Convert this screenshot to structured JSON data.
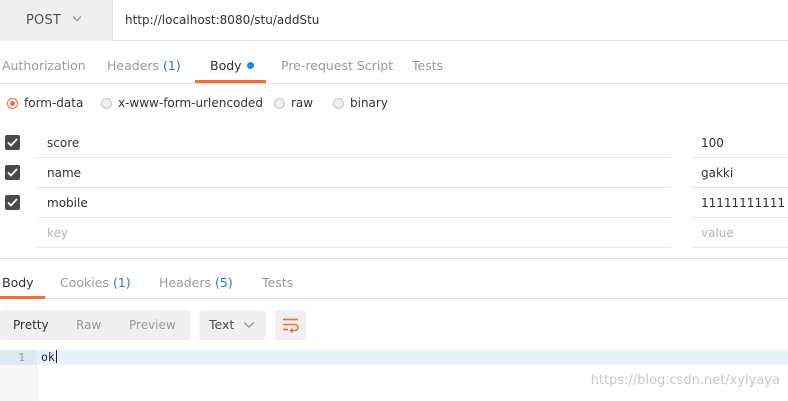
{
  "request": {
    "method": "POST",
    "url": "http://localhost:8080/stu/addStu"
  },
  "request_tabs": [
    {
      "label": "Authorization",
      "count": ""
    },
    {
      "label": "Headers",
      "count": "(1)"
    },
    {
      "label": "Body",
      "count": ""
    },
    {
      "label": "Pre-request Script",
      "count": ""
    },
    {
      "label": "Tests",
      "count": ""
    }
  ],
  "active_request_tab": "Body",
  "body_types": [
    {
      "label": "form-data",
      "selected": true
    },
    {
      "label": "x-www-form-urlencoded",
      "selected": false
    },
    {
      "label": "raw",
      "selected": false
    },
    {
      "label": "binary",
      "selected": false
    }
  ],
  "form_rows": [
    {
      "checked": true,
      "key": "score",
      "value": "100"
    },
    {
      "checked": true,
      "key": "name",
      "value": "gakki"
    },
    {
      "checked": true,
      "key": "mobile",
      "value": "11111111111"
    }
  ],
  "new_row": {
    "key_placeholder": "key",
    "value_placeholder": "value"
  },
  "response_tabs": [
    {
      "label": "Body",
      "count": ""
    },
    {
      "label": "Cookies",
      "count": "(1)"
    },
    {
      "label": "Headers",
      "count": "(5)"
    },
    {
      "label": "Tests",
      "count": ""
    }
  ],
  "active_response_tab": "Body",
  "view_modes": [
    "Pretty",
    "Raw",
    "Preview"
  ],
  "active_view_mode": "Pretty",
  "format": "Text",
  "response_lines": [
    {
      "number": "1",
      "text": "ok"
    }
  ],
  "watermark": "https://blog.csdn.net/xylyaya",
  "colors": {
    "accent": "#f26b3a",
    "link": "#2b7bc9",
    "dot": "#1e88e5"
  }
}
